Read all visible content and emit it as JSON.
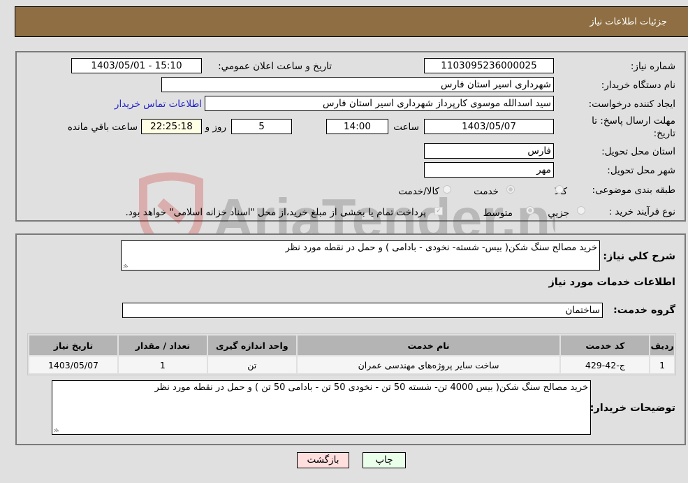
{
  "header": {
    "title": "جزئیات اطلاعات نیاز"
  },
  "form": {
    "need_number_label": "شماره نیاز:",
    "need_number": "1103095236000025",
    "announce_label": "تاریخ و ساعت اعلان عمومي:",
    "announce_value": "1403/05/01 - 15:10",
    "buyer_org_label": "نام دستگاه خریدار:",
    "buyer_org": "شهرداری اسیر استان فارس",
    "creator_label": "ایجاد کننده درخواست:",
    "creator": "سید اسدالله موسوی کارپرداز شهرداری اسیر استان فارس",
    "contact_link": "اطلاعات تماس خریدار",
    "deadline_label_line1": "مهلت ارسال پاسخ: تا",
    "deadline_label_line2": "تاریخ:",
    "deadline_date": "1403/05/07",
    "time_label": "ساعت",
    "deadline_time": "14:00",
    "days_value": "5",
    "days_label": "روز و",
    "remaining_time": "22:25:18",
    "remaining_label": "ساعت باقي مانده",
    "province_label": "استان محل تحویل:",
    "province": "فارس",
    "city_label": "شهر محل تحویل:",
    "city": "مهر",
    "category_label": "طبقه بندی موضوعی:",
    "category_options": [
      {
        "label": "کالا",
        "checked": false
      },
      {
        "label": "خدمت",
        "checked": true
      },
      {
        "label": "کالا/خدمت",
        "checked": false
      }
    ],
    "process_label": "نوع فرآیند خرید :",
    "process_options": [
      {
        "label": "جزيي",
        "checked": false
      },
      {
        "label": "متوسط",
        "checked": true
      }
    ],
    "treasury_checkbox_checked": true,
    "treasury_note": "پرداخت تمام یا بخشی از مبلغ خرید،از محل \"اسناد خزانه اسلامی\" خواهد بود."
  },
  "details": {
    "summary_label": "شرح کلي نیاز:",
    "summary": "خرید مصالح سنگ شکن( بیس- شسته- نخودی - بادامی ) و حمل در نقطه مورد نظر",
    "services_heading": "اطلاعات خدمات مورد نیاز",
    "service_group_label": "گروه خدمت:",
    "service_group": "ساختمان",
    "table": {
      "headers": [
        "ردیف",
        "کد خدمت",
        "نام خدمت",
        "واحد اندازه گیری",
        "تعداد / مقدار",
        "تاریخ نیاز"
      ],
      "rows": [
        [
          "1",
          "ج-42-429",
          "ساخت سایر پروژه‌های مهندسی عمران",
          "تن",
          "1",
          "1403/05/07"
        ]
      ]
    },
    "buyer_notes_label": "توضیحات خریدار:",
    "buyer_notes": "خرید مصالح سنگ شکن( بیس 4000 تن- شسته 50 تن - نخودی 50 تن  - بادامی 50 تن  ) و حمل در نقطه مورد نظر"
  },
  "buttons": {
    "print": "چاپ",
    "back": "بازگشت"
  },
  "colors": {
    "header_bg": "#8e6e42",
    "print_bg": "#eaffea",
    "back_bg": "#ffdede",
    "link": "#2222cc"
  },
  "watermark": "AriaTender.neT"
}
